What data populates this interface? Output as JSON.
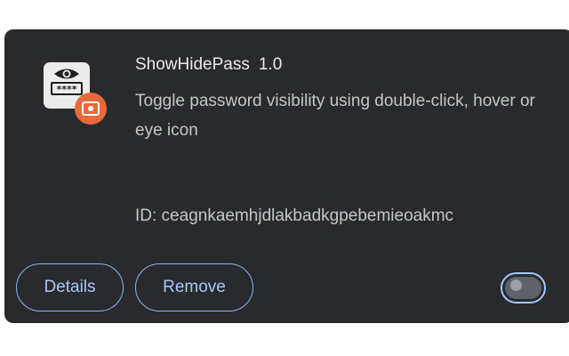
{
  "extension": {
    "name": "ShowHidePass",
    "version": "1.0",
    "description": "Toggle password visibility using double-click, hover or eye icon",
    "id_text": "ID: ceagnkaemhjdlakbadkgpebemieoakmc",
    "icon": "eye-password-icon",
    "badge_icon": "policy-badge-icon"
  },
  "actions": {
    "details_label": "Details",
    "remove_label": "Remove"
  },
  "toggle": {
    "enabled": false
  },
  "colors": {
    "card_background": "#292a2d",
    "accent": "#8ab4f8",
    "badge": "#e8693b"
  }
}
